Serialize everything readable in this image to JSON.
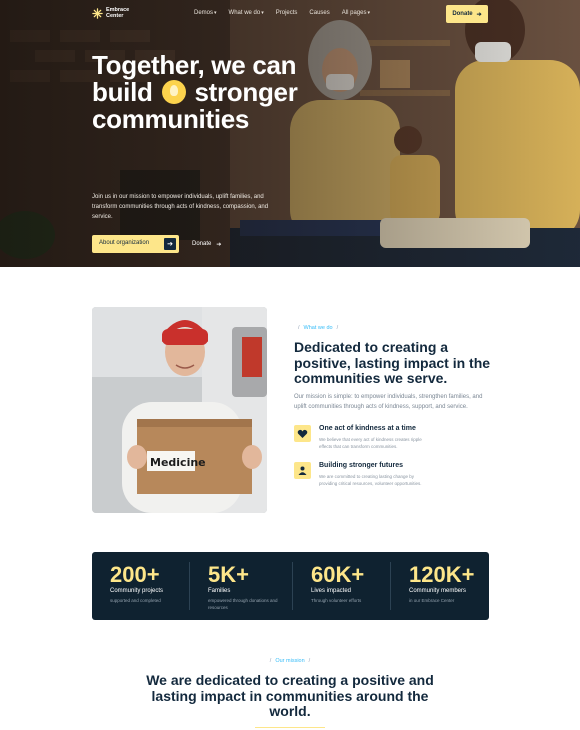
{
  "nav": {
    "logo_text": "Embrace Center",
    "links": [
      {
        "label": "Demos",
        "has_caret": true
      },
      {
        "label": "What we do",
        "has_caret": true
      },
      {
        "label": "Projects",
        "has_caret": false
      },
      {
        "label": "Causes",
        "has_caret": false
      },
      {
        "label": "All pages",
        "has_caret": true
      }
    ],
    "donate_label": "Donate",
    "caret_glyph": "▾",
    "arrow_glyph": "➔"
  },
  "hero": {
    "title_line1": "Together, we can",
    "title_line2_a": "build",
    "title_line2_b": "stronger",
    "title_line3": "communities",
    "description": "Join us in our mission to empower individuals, uplift families, and transform communities through acts of kindness, compassion, and service.",
    "about_button": "About organization",
    "donate_button": "Donate"
  },
  "about": {
    "eyebrow": "What we do",
    "title": "Dedicated to creating a positive, lasting impact in the communities we serve.",
    "text": "Our mission is simple: to empower individuals, strengthen families, and uplift communities through acts of kindness, support, and service.",
    "box_label": "Medicine",
    "features": [
      {
        "title": "One act of kindness at a time",
        "text": "We believe that every act of kindness creates ripple effects that can transform communities.",
        "icon": "heart-hands-icon"
      },
      {
        "title": "Building stronger futures",
        "text": "We are committed to creating lasting change by providing critical resources, volunteer opportunities.",
        "icon": "people-icon"
      }
    ]
  },
  "stats": [
    {
      "value": "200+",
      "label": "Community projects",
      "sub": "supported and completed"
    },
    {
      "value": "5K+",
      "label": "Families",
      "sub": "empowered through donations and resources"
    },
    {
      "value": "60K+",
      "label": "Lives impacted",
      "sub": "Through volunteer efforts"
    },
    {
      "value": "120K+",
      "label": "Community members",
      "sub": "in our Embrace Center"
    }
  ],
  "mission": {
    "eyebrow": "Our mission",
    "title": "We are dedicated to creating a positive and lasting impact in communities around the world."
  },
  "colors": {
    "accent_yellow": "#fde68a",
    "navy": "#13293d",
    "eyebrow_blue": "#38bdf8",
    "stats_bg": "#0f2230"
  }
}
